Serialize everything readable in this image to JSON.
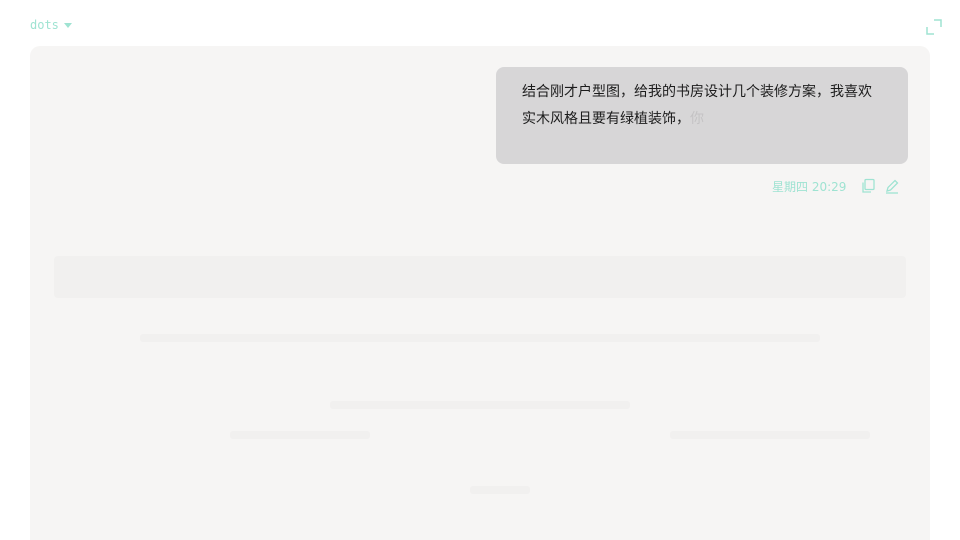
{
  "header": {
    "model_label": "dots"
  },
  "message": {
    "text_main": "结合刚才户型图，给我的书房设计几个装修方案，我喜欢实木风格且要有绿植装饰，",
    "text_faded": "你",
    "timestamp": "星期四 20:29"
  },
  "colors": {
    "accent": "#9fe3d2",
    "panel_bg": "#f6f5f4",
    "bubble_bg": "#d7d6d7"
  },
  "icons": [
    "chevron-down-icon",
    "expand-icon",
    "copy-icon",
    "edit-icon"
  ]
}
